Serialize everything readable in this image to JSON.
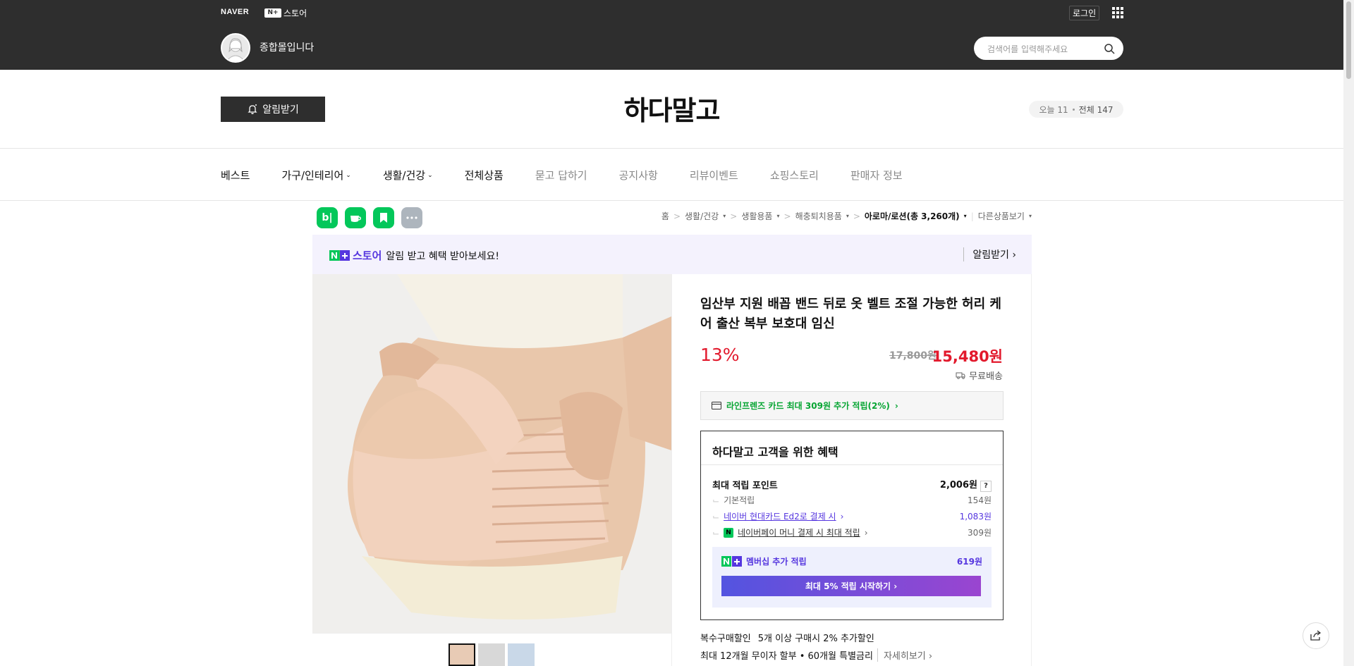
{
  "topbar": {
    "naver_label": "NAVER",
    "nplus_label": "N+",
    "store_label": "스토어",
    "login_label": "로그인",
    "store_name": "종합몰입니다",
    "search_placeholder": "검색어를 입력해주세요"
  },
  "header": {
    "notify_label": "알림받기",
    "shop_title": "하다말고",
    "visitors_today": "오늘 11",
    "visitors_total": "전체 147"
  },
  "nav": {
    "items": [
      "베스트",
      "가구/인테리어",
      "생활/건강",
      "전체상품",
      "묻고 답하기",
      "공지사항",
      "리뷰이벤트",
      "쇼핑스토리",
      "판매자 정보"
    ]
  },
  "sns": {
    "blog": "b|"
  },
  "breadcrumb": {
    "items": [
      "홈",
      "생활/건강",
      "생활용품",
      "해충퇴치용품",
      "아로마/로션(총 3,260개)"
    ],
    "other": "다른상품보기"
  },
  "banner": {
    "store": "스토어",
    "message": "알림 받고 혜택 받아보세요!",
    "action": "알림받기"
  },
  "product": {
    "title": "임산부 지원 배꼽 밴드 뒤로 옷 벨트 조절 가능한 허리 케어 출산 복부 보호대 임신",
    "discount": "13%",
    "original_price": "17,800원",
    "price": "15,480원",
    "shipping": "무료배송",
    "card_offer": "라인프렌즈 카드 최대 309원 추가 적립(2%)"
  },
  "benefit": {
    "heading": "하다말고 고객을 위한 혜택",
    "max_label": "최대 적립 포인트",
    "max_value": "2,006원",
    "qmark": "?",
    "base_label": "기본적립",
    "base_value": "154원",
    "card_label": "네이버 현대카드 Ed2로 결제 시",
    "card_value": "1,083원",
    "pay_label": "네이버페이 머니 결제 시 최대 적립",
    "pay_value": "309원",
    "member_label": "멤버십 추가 적립",
    "member_value": "619원",
    "member_btn": "최대 5% 적립 시작하기"
  },
  "extra": {
    "bulk_label": "복수구매할인",
    "bulk_value": "5개 이상 구매시 2% 추가할인",
    "installment": "최대 12개월 무이자 할부 • 60개월 특별금리",
    "more": "자세히보기"
  },
  "colors": {
    "dark": "#2e2e2e",
    "price_red": "#e2192c",
    "naver_green": "#03c75a",
    "purple": "#5536df"
  }
}
